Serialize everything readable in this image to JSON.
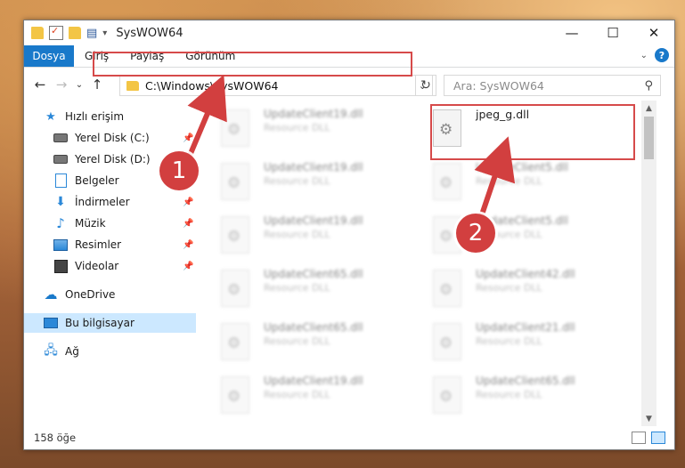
{
  "window": {
    "title": "SysWOW64",
    "controls": {
      "minimize": "—",
      "maximize": "☐",
      "close": "✕"
    }
  },
  "ribbon": {
    "tabs": [
      "Dosya",
      "Giriş",
      "Paylaş",
      "Görünüm"
    ],
    "help": "?"
  },
  "address_bar": {
    "path": "C:\\Windows\\SysWOW64",
    "search_placeholder": "Ara: SysWOW64"
  },
  "nav": {
    "items": [
      {
        "label": "Hızlı erişim",
        "icon": "star-icon"
      },
      {
        "label": "Yerel Disk (C:)",
        "icon": "disk-icon",
        "pinned": true
      },
      {
        "label": "Yerel Disk (D:)",
        "icon": "disk-icon",
        "pinned": true
      },
      {
        "label": "Belgeler",
        "icon": "document-icon",
        "pinned": true
      },
      {
        "label": "İndirmeler",
        "icon": "download-icon",
        "pinned": true
      },
      {
        "label": "Müzik",
        "icon": "music-icon",
        "pinned": true
      },
      {
        "label": "Resimler",
        "icon": "picture-icon",
        "pinned": true
      },
      {
        "label": "Videolar",
        "icon": "video-icon",
        "pinned": true
      },
      {
        "label": "OneDrive",
        "icon": "cloud-icon"
      },
      {
        "label": "Bu bilgisayar",
        "icon": "computer-icon",
        "selected": true
      },
      {
        "label": "Ağ",
        "icon": "network-icon"
      }
    ]
  },
  "files": {
    "left_column": [
      {
        "name": "UpdateClient19.dll",
        "type": "Resource DLL"
      },
      {
        "name": "UpdateClient19.dll",
        "type": "Resource DLL"
      },
      {
        "name": "UpdateClient19.dll",
        "type": "Resource DLL"
      },
      {
        "name": "UpdateClient65.dll",
        "type": "Resource DLL"
      },
      {
        "name": "UpdateClient65.dll",
        "type": "Resource DLL"
      },
      {
        "name": "UpdateClient19.dll",
        "type": "Resource DLL"
      }
    ],
    "right_column": [
      {
        "name": "jpeg_g.dll",
        "type": ""
      },
      {
        "name": "UpdateClient5.dll",
        "type": "Resource DLL"
      },
      {
        "name": "UpdateClient5.dll",
        "type": "Resource DLL"
      },
      {
        "name": "UpdateClient42.dll",
        "type": "Resource DLL"
      },
      {
        "name": "UpdateClient21.dll",
        "type": "Resource DLL"
      },
      {
        "name": "UpdateClient65.dll",
        "type": "Resource DLL"
      }
    ]
  },
  "status": {
    "count": "158 öğe"
  },
  "annotations": {
    "badge1": "1",
    "badge2": "2",
    "color": "#d23f3f"
  }
}
